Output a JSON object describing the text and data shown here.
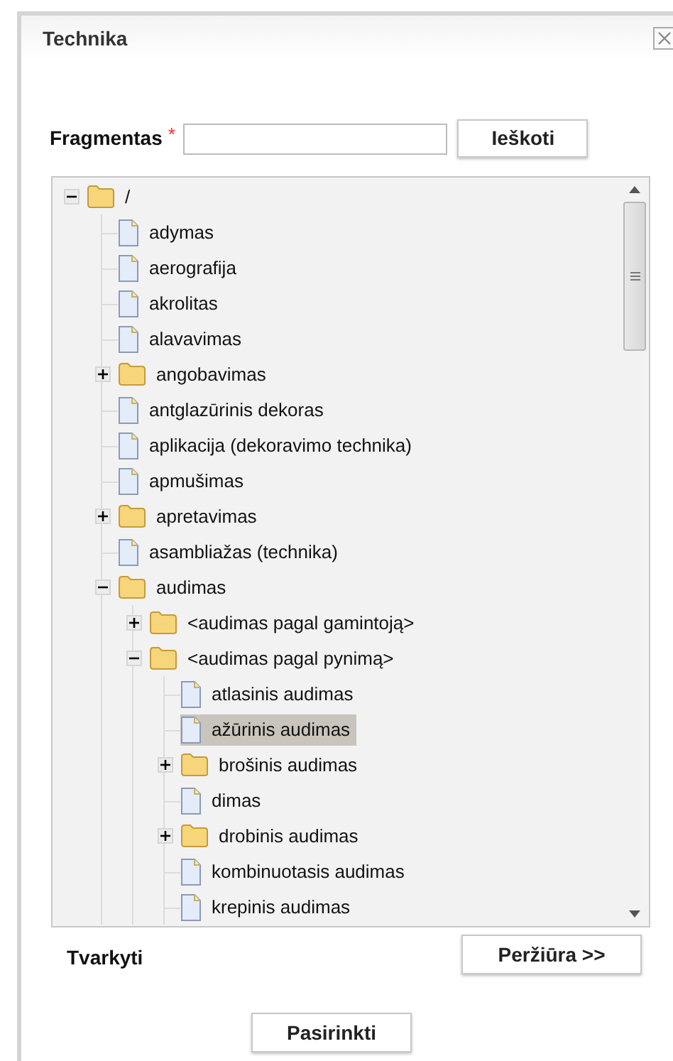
{
  "dialog": {
    "title": "Technika"
  },
  "search": {
    "label": "Fragmentas",
    "required_mark": "*",
    "button": "Ieškoti"
  },
  "tree": [
    {
      "label": "/",
      "kind": "folder",
      "expanded": true,
      "selected": false,
      "children": [
        {
          "label": "adymas",
          "kind": "file",
          "selected": false
        },
        {
          "label": "aerografija",
          "kind": "file",
          "selected": false
        },
        {
          "label": "akrolitas",
          "kind": "file",
          "selected": false
        },
        {
          "label": "alavavimas",
          "kind": "file",
          "selected": false
        },
        {
          "label": "angobavimas",
          "kind": "folder",
          "expanded": false,
          "selected": false
        },
        {
          "label": "antglazūrinis dekoras",
          "kind": "file",
          "selected": false
        },
        {
          "label": "aplikacija (dekoravimo technika)",
          "kind": "file",
          "selected": false
        },
        {
          "label": "apmušimas",
          "kind": "file",
          "selected": false
        },
        {
          "label": "apretavimas",
          "kind": "folder",
          "expanded": false,
          "selected": false
        },
        {
          "label": "asambliažas (technika)",
          "kind": "file",
          "selected": false
        },
        {
          "label": "audimas",
          "kind": "folder",
          "expanded": true,
          "selected": false,
          "children": [
            {
              "label": "<audimas pagal gamintoją>",
              "kind": "folder",
              "expanded": false,
              "selected": false
            },
            {
              "label": "<audimas pagal pynimą>",
              "kind": "folder",
              "expanded": true,
              "selected": false,
              "children": [
                {
                  "label": "atlasinis audimas",
                  "kind": "file",
                  "selected": false
                },
                {
                  "label": "ažūrinis audimas",
                  "kind": "file",
                  "selected": true
                },
                {
                  "label": "brošinis audimas",
                  "kind": "folder",
                  "expanded": false,
                  "selected": false
                },
                {
                  "label": "dimas",
                  "kind": "file",
                  "selected": false
                },
                {
                  "label": "drobinis audimas",
                  "kind": "folder",
                  "expanded": false,
                  "selected": false
                },
                {
                  "label": "kombinuotasis audimas",
                  "kind": "file",
                  "selected": false
                },
                {
                  "label": "krepinis audimas",
                  "kind": "file",
                  "selected": false
                }
              ]
            }
          ]
        }
      ]
    }
  ],
  "footer": {
    "manage_label": "Tvarkyti",
    "preview_button": "Peržiūra >>",
    "choose_button": "Pasirinkti"
  }
}
